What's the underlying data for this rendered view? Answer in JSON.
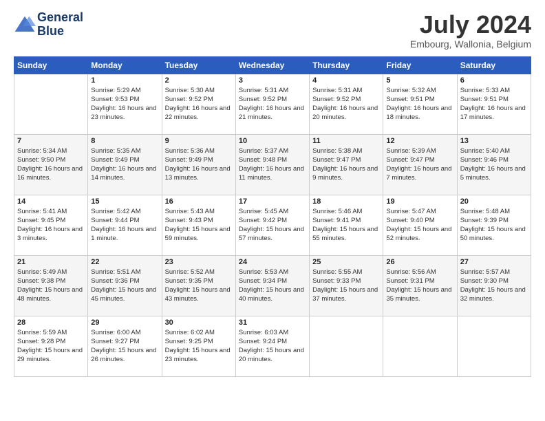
{
  "header": {
    "logo_line1": "General",
    "logo_line2": "Blue",
    "title": "July 2024",
    "location": "Embourg, Wallonia, Belgium"
  },
  "columns": [
    "Sunday",
    "Monday",
    "Tuesday",
    "Wednesday",
    "Thursday",
    "Friday",
    "Saturday"
  ],
  "weeks": [
    [
      {
        "day": "",
        "sunrise": "",
        "sunset": "",
        "daylight": ""
      },
      {
        "day": "1",
        "sunrise": "Sunrise: 5:29 AM",
        "sunset": "Sunset: 9:53 PM",
        "daylight": "Daylight: 16 hours and 23 minutes."
      },
      {
        "day": "2",
        "sunrise": "Sunrise: 5:30 AM",
        "sunset": "Sunset: 9:52 PM",
        "daylight": "Daylight: 16 hours and 22 minutes."
      },
      {
        "day": "3",
        "sunrise": "Sunrise: 5:31 AM",
        "sunset": "Sunset: 9:52 PM",
        "daylight": "Daylight: 16 hours and 21 minutes."
      },
      {
        "day": "4",
        "sunrise": "Sunrise: 5:31 AM",
        "sunset": "Sunset: 9:52 PM",
        "daylight": "Daylight: 16 hours and 20 minutes."
      },
      {
        "day": "5",
        "sunrise": "Sunrise: 5:32 AM",
        "sunset": "Sunset: 9:51 PM",
        "daylight": "Daylight: 16 hours and 18 minutes."
      },
      {
        "day": "6",
        "sunrise": "Sunrise: 5:33 AM",
        "sunset": "Sunset: 9:51 PM",
        "daylight": "Daylight: 16 hours and 17 minutes."
      }
    ],
    [
      {
        "day": "7",
        "sunrise": "Sunrise: 5:34 AM",
        "sunset": "Sunset: 9:50 PM",
        "daylight": "Daylight: 16 hours and 16 minutes."
      },
      {
        "day": "8",
        "sunrise": "Sunrise: 5:35 AM",
        "sunset": "Sunset: 9:49 PM",
        "daylight": "Daylight: 16 hours and 14 minutes."
      },
      {
        "day": "9",
        "sunrise": "Sunrise: 5:36 AM",
        "sunset": "Sunset: 9:49 PM",
        "daylight": "Daylight: 16 hours and 13 minutes."
      },
      {
        "day": "10",
        "sunrise": "Sunrise: 5:37 AM",
        "sunset": "Sunset: 9:48 PM",
        "daylight": "Daylight: 16 hours and 11 minutes."
      },
      {
        "day": "11",
        "sunrise": "Sunrise: 5:38 AM",
        "sunset": "Sunset: 9:47 PM",
        "daylight": "Daylight: 16 hours and 9 minutes."
      },
      {
        "day": "12",
        "sunrise": "Sunrise: 5:39 AM",
        "sunset": "Sunset: 9:47 PM",
        "daylight": "Daylight: 16 hours and 7 minutes."
      },
      {
        "day": "13",
        "sunrise": "Sunrise: 5:40 AM",
        "sunset": "Sunset: 9:46 PM",
        "daylight": "Daylight: 16 hours and 5 minutes."
      }
    ],
    [
      {
        "day": "14",
        "sunrise": "Sunrise: 5:41 AM",
        "sunset": "Sunset: 9:45 PM",
        "daylight": "Daylight: 16 hours and 3 minutes."
      },
      {
        "day": "15",
        "sunrise": "Sunrise: 5:42 AM",
        "sunset": "Sunset: 9:44 PM",
        "daylight": "Daylight: 16 hours and 1 minute."
      },
      {
        "day": "16",
        "sunrise": "Sunrise: 5:43 AM",
        "sunset": "Sunset: 9:43 PM",
        "daylight": "Daylight: 15 hours and 59 minutes."
      },
      {
        "day": "17",
        "sunrise": "Sunrise: 5:45 AM",
        "sunset": "Sunset: 9:42 PM",
        "daylight": "Daylight: 15 hours and 57 minutes."
      },
      {
        "day": "18",
        "sunrise": "Sunrise: 5:46 AM",
        "sunset": "Sunset: 9:41 PM",
        "daylight": "Daylight: 15 hours and 55 minutes."
      },
      {
        "day": "19",
        "sunrise": "Sunrise: 5:47 AM",
        "sunset": "Sunset: 9:40 PM",
        "daylight": "Daylight: 15 hours and 52 minutes."
      },
      {
        "day": "20",
        "sunrise": "Sunrise: 5:48 AM",
        "sunset": "Sunset: 9:39 PM",
        "daylight": "Daylight: 15 hours and 50 minutes."
      }
    ],
    [
      {
        "day": "21",
        "sunrise": "Sunrise: 5:49 AM",
        "sunset": "Sunset: 9:38 PM",
        "daylight": "Daylight: 15 hours and 48 minutes."
      },
      {
        "day": "22",
        "sunrise": "Sunrise: 5:51 AM",
        "sunset": "Sunset: 9:36 PM",
        "daylight": "Daylight: 15 hours and 45 minutes."
      },
      {
        "day": "23",
        "sunrise": "Sunrise: 5:52 AM",
        "sunset": "Sunset: 9:35 PM",
        "daylight": "Daylight: 15 hours and 43 minutes."
      },
      {
        "day": "24",
        "sunrise": "Sunrise: 5:53 AM",
        "sunset": "Sunset: 9:34 PM",
        "daylight": "Daylight: 15 hours and 40 minutes."
      },
      {
        "day": "25",
        "sunrise": "Sunrise: 5:55 AM",
        "sunset": "Sunset: 9:33 PM",
        "daylight": "Daylight: 15 hours and 37 minutes."
      },
      {
        "day": "26",
        "sunrise": "Sunrise: 5:56 AM",
        "sunset": "Sunset: 9:31 PM",
        "daylight": "Daylight: 15 hours and 35 minutes."
      },
      {
        "day": "27",
        "sunrise": "Sunrise: 5:57 AM",
        "sunset": "Sunset: 9:30 PM",
        "daylight": "Daylight: 15 hours and 32 minutes."
      }
    ],
    [
      {
        "day": "28",
        "sunrise": "Sunrise: 5:59 AM",
        "sunset": "Sunset: 9:28 PM",
        "daylight": "Daylight: 15 hours and 29 minutes."
      },
      {
        "day": "29",
        "sunrise": "Sunrise: 6:00 AM",
        "sunset": "Sunset: 9:27 PM",
        "daylight": "Daylight: 15 hours and 26 minutes."
      },
      {
        "day": "30",
        "sunrise": "Sunrise: 6:02 AM",
        "sunset": "Sunset: 9:25 PM",
        "daylight": "Daylight: 15 hours and 23 minutes."
      },
      {
        "day": "31",
        "sunrise": "Sunrise: 6:03 AM",
        "sunset": "Sunset: 9:24 PM",
        "daylight": "Daylight: 15 hours and 20 minutes."
      },
      {
        "day": "",
        "sunrise": "",
        "sunset": "",
        "daylight": ""
      },
      {
        "day": "",
        "sunrise": "",
        "sunset": "",
        "daylight": ""
      },
      {
        "day": "",
        "sunrise": "",
        "sunset": "",
        "daylight": ""
      }
    ]
  ]
}
